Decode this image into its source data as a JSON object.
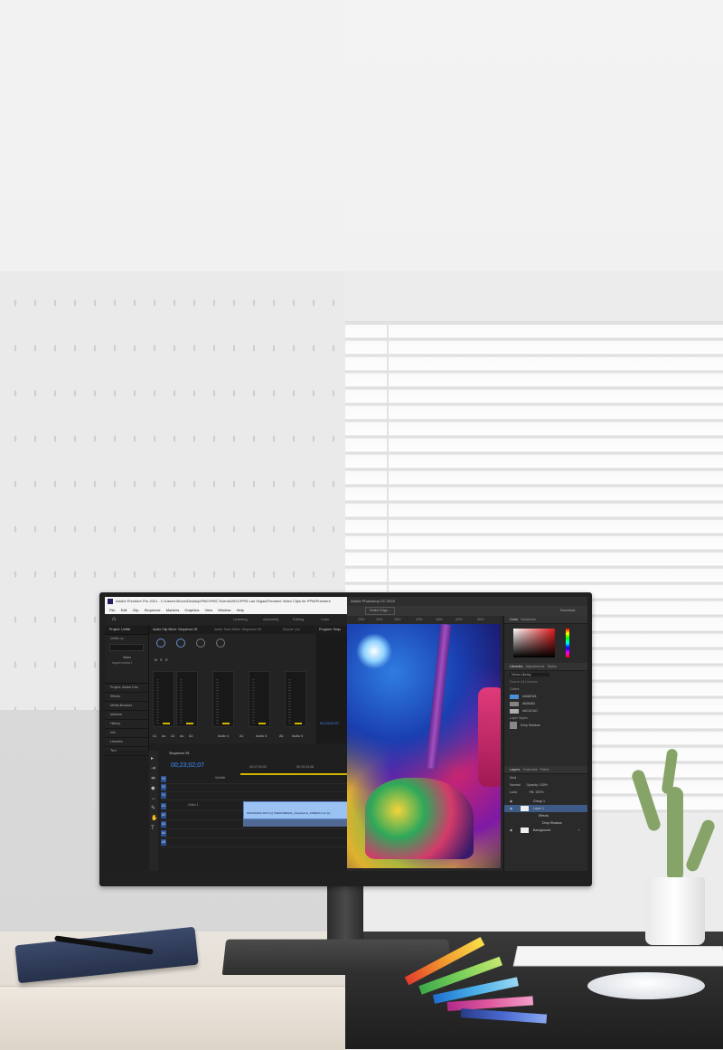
{
  "premiere": {
    "title": "Adobe Premiere Pro 2021 - C:\\Users\\Xboxs\\Desktop\\PMC\\PMC Events\\2021\\PPM Las Vegas\\Premiere Video Clips for PPM\\Premiere",
    "menu": [
      "File",
      "Edit",
      "Clip",
      "Sequence",
      "Markers",
      "Graphics",
      "View",
      "Window",
      "Help"
    ],
    "workspaces": [
      "Learning",
      "Assembly",
      "Editing",
      "Color"
    ],
    "panel_tabs": {
      "project": "Project: Untitle",
      "audio_clip_mixer": "Audio Clip Mixer: Sequence 05",
      "audio_track_mixer": "Audio Track Mixer: Sequence 05",
      "source": "Source: (no",
      "program": "Program: Sequ"
    },
    "project_panel": {
      "file": "Untitle..rp",
      "name_header": "Name",
      "import": "Import media t"
    },
    "side_panels": [
      "Project: Adobe Kits",
      "Effects",
      "Media Browser",
      "Markers",
      "History",
      "Info",
      "Libraries",
      "Text"
    ],
    "mixer_channels": [
      "A1",
      "Au",
      "A2",
      "Au",
      "A3",
      "Audio 4",
      "A1",
      "Audio 5",
      "A6",
      "Audio 6"
    ],
    "mixer_buttons": [
      "M",
      "S",
      "R"
    ],
    "sequence_tab": "Sequence 05",
    "timecode": "00;23;02;07",
    "program_timecode": "00;23;02;07",
    "ruler": [
      "00;17;03;02",
      "00;19;13;06"
    ],
    "tracks": [
      "V3",
      "V2",
      "V1",
      "A1",
      "A2",
      "A3",
      "A4",
      "A5"
    ],
    "track_name_v1": "Video 1",
    "track_name_v3": "Subtitle",
    "clip_name": "WM1016202.MOV [V] PHENOMENAL_Daydreams_1088p60.mov [V]"
  },
  "photoshop": {
    "title": "Adobe Photoshop CC 2015",
    "options": "Refine Edge...",
    "workspace": "Essentials",
    "ruler": [
      "2500",
      "3000",
      "3500",
      "4000",
      "4500",
      "5000",
      "5500"
    ],
    "color_tabs": [
      "Color",
      "Swatches"
    ],
    "libraries_tabs": [
      "Libraries",
      "Adjustments",
      "Styles"
    ],
    "library_select": "Demo Library",
    "library_search": "Search All Libraries",
    "colors_header": "Colors",
    "swatches": [
      {
        "hex": "#4a8ed8",
        "label": "#4A8ED8"
      },
      {
        "hex": "#848484",
        "label": "#848484"
      },
      {
        "hex": "#acacac",
        "label": "#ACACAC"
      }
    ],
    "layer_styles_header": "Layer Styles",
    "layer_style": "Drop Shadow",
    "layers_tabs": [
      "Layers",
      "Channels",
      "Paths"
    ],
    "kind": "Kind",
    "blend": "Normal",
    "opacity": "Opacity: 100%",
    "fill": "Fill: 100%",
    "lock": "Lock:",
    "layers": [
      "Group 1",
      "Layer 1",
      "Effects",
      "Drop Shadow",
      "Background"
    ]
  }
}
